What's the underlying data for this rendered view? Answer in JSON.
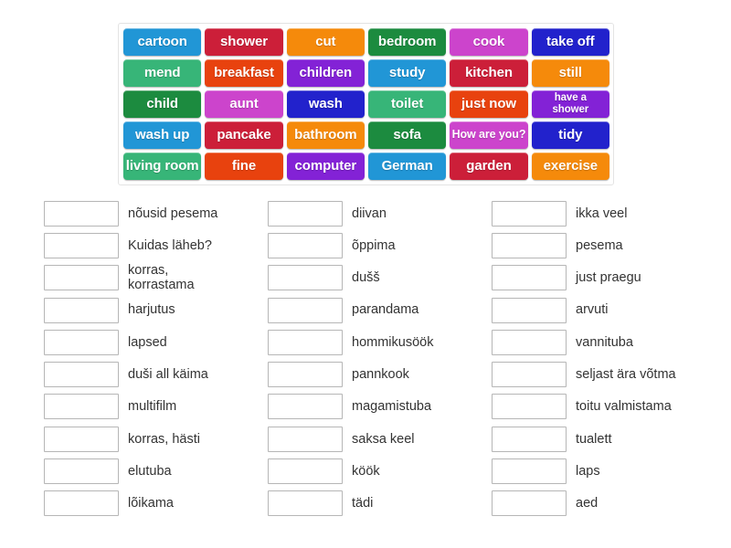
{
  "tile_bank": {
    "name": "word-tile-bank",
    "rows": [
      [
        {
          "label": "cartoon",
          "color": "#2196d6",
          "size": "normal"
        },
        {
          "label": "shower",
          "color": "#cc1f39",
          "size": "normal"
        },
        {
          "label": "cut",
          "color": "#f58a0b",
          "size": "normal"
        },
        {
          "label": "bedroom",
          "color": "#1c8b3f",
          "size": "normal"
        },
        {
          "label": "cook",
          "color": "#cc44cc",
          "size": "normal"
        },
        {
          "label": "take off",
          "color": "#2222cc",
          "size": "normal"
        }
      ],
      [
        {
          "label": "mend",
          "color": "#37b578",
          "size": "normal"
        },
        {
          "label": "breakfast",
          "color": "#e8420e",
          "size": "normal"
        },
        {
          "label": "children",
          "color": "#8322d6",
          "size": "normal"
        },
        {
          "label": "study",
          "color": "#2196d6",
          "size": "normal"
        },
        {
          "label": "kitchen",
          "color": "#cc1f39",
          "size": "normal"
        },
        {
          "label": "still",
          "color": "#f58a0b",
          "size": "normal"
        }
      ],
      [
        {
          "label": "child",
          "color": "#1c8b3f",
          "size": "normal"
        },
        {
          "label": "aunt",
          "color": "#cc44cc",
          "size": "normal"
        },
        {
          "label": "wash",
          "color": "#2222cc",
          "size": "normal"
        },
        {
          "label": "toilet",
          "color": "#37b578",
          "size": "normal"
        },
        {
          "label": "just now",
          "color": "#e8420e",
          "size": "normal"
        },
        {
          "label": "have a\nshower",
          "color": "#8322d6",
          "size": "small"
        }
      ],
      [
        {
          "label": "wash up",
          "color": "#2196d6",
          "size": "normal"
        },
        {
          "label": "pancake",
          "color": "#cc1f39",
          "size": "normal"
        },
        {
          "label": "bathroom",
          "color": "#f58a0b",
          "size": "normal"
        },
        {
          "label": "sofa",
          "color": "#1c8b3f",
          "size": "normal"
        },
        {
          "label": "How are you?",
          "color": "#cc44cc",
          "size": "xsmall"
        },
        {
          "label": "tidy",
          "color": "#2222cc",
          "size": "normal"
        }
      ],
      [
        {
          "label": "living room",
          "color": "#37b578",
          "size": "normal"
        },
        {
          "label": "fine",
          "color": "#e8420e",
          "size": "normal"
        },
        {
          "label": "computer",
          "color": "#8322d6",
          "size": "normal"
        },
        {
          "label": "German",
          "color": "#2196d6",
          "size": "normal"
        },
        {
          "label": "garden",
          "color": "#cc1f39",
          "size": "normal"
        },
        {
          "label": "exercise",
          "color": "#f58a0b",
          "size": "normal"
        }
      ]
    ]
  },
  "answers": {
    "columns": [
      {
        "items": [
          {
            "label": "nõusid pesema",
            "value": ""
          },
          {
            "label": "Kuidas läheb?",
            "value": ""
          },
          {
            "label": "korras,\nkorrastama",
            "value": ""
          },
          {
            "label": "harjutus",
            "value": ""
          },
          {
            "label": "lapsed",
            "value": ""
          },
          {
            "label": "duši all käima",
            "value": ""
          },
          {
            "label": "multifilm",
            "value": ""
          },
          {
            "label": "korras, hästi",
            "value": ""
          },
          {
            "label": "elutuba",
            "value": ""
          },
          {
            "label": "lõikama",
            "value": ""
          }
        ]
      },
      {
        "items": [
          {
            "label": "diivan",
            "value": ""
          },
          {
            "label": "õppima",
            "value": ""
          },
          {
            "label": "dušš",
            "value": ""
          },
          {
            "label": "parandama",
            "value": ""
          },
          {
            "label": "hommikusöök",
            "value": ""
          },
          {
            "label": "pannkook",
            "value": ""
          },
          {
            "label": "magamistuba",
            "value": ""
          },
          {
            "label": "saksa keel",
            "value": ""
          },
          {
            "label": "köök",
            "value": ""
          },
          {
            "label": "tädi",
            "value": ""
          }
        ]
      },
      {
        "items": [
          {
            "label": "ikka veel",
            "value": ""
          },
          {
            "label": "pesema",
            "value": ""
          },
          {
            "label": "just praegu",
            "value": ""
          },
          {
            "label": "arvuti",
            "value": ""
          },
          {
            "label": "vannituba",
            "value": ""
          },
          {
            "label": "seljast ära võtma",
            "value": ""
          },
          {
            "label": "toitu valmistama",
            "value": ""
          },
          {
            "label": "tualett",
            "value": ""
          },
          {
            "label": "laps",
            "value": ""
          },
          {
            "label": "aed",
            "value": ""
          }
        ]
      }
    ]
  }
}
